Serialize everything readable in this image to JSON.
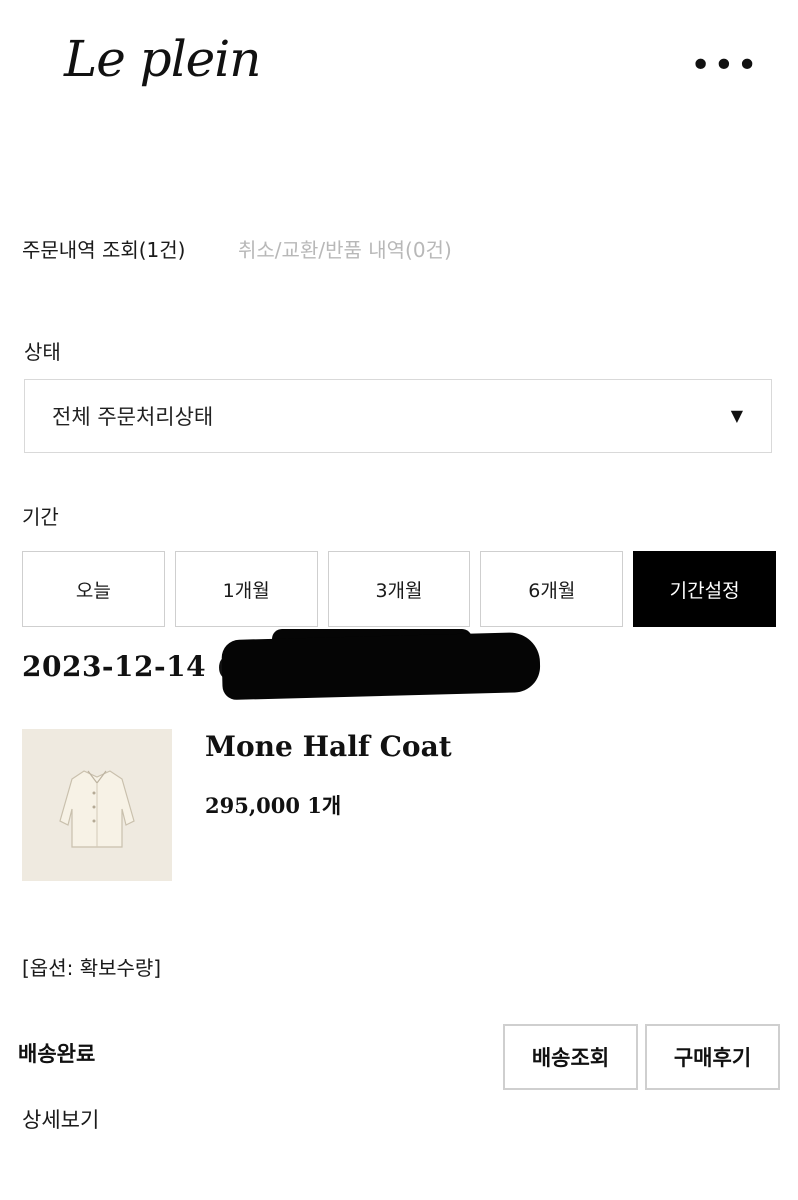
{
  "header": {
    "logo_text": "Le plein",
    "menu_icon": "more-horizontal-icon",
    "menu_glyph": "•••"
  },
  "tabs": [
    {
      "label": "주문내역 조회(1건)",
      "active": true
    },
    {
      "label": "취소/교환/반품 내역(0건)",
      "active": false
    }
  ],
  "filters": {
    "status_label": "상태",
    "status_value": "전체 주문처리상태",
    "period_label": "기간",
    "period_buttons": [
      "오늘",
      "1개월",
      "3개월",
      "6개월",
      "기간설정"
    ],
    "period_selected": "기간설정"
  },
  "order": {
    "date_visible": "2023-12-14 (2",
    "product_name": "Mone Half Coat",
    "price_qty": "295,000 1개",
    "option": "[옵션: 확보수량]",
    "status": "배송완료",
    "actions": [
      "배송조회",
      "구매후기"
    ],
    "detail_link": "상세보기"
  },
  "colors": {
    "accent": "#000000",
    "muted_text": "#b8b8b8",
    "border": "#cfcfcf",
    "thumb_bg": "#efeae0"
  }
}
